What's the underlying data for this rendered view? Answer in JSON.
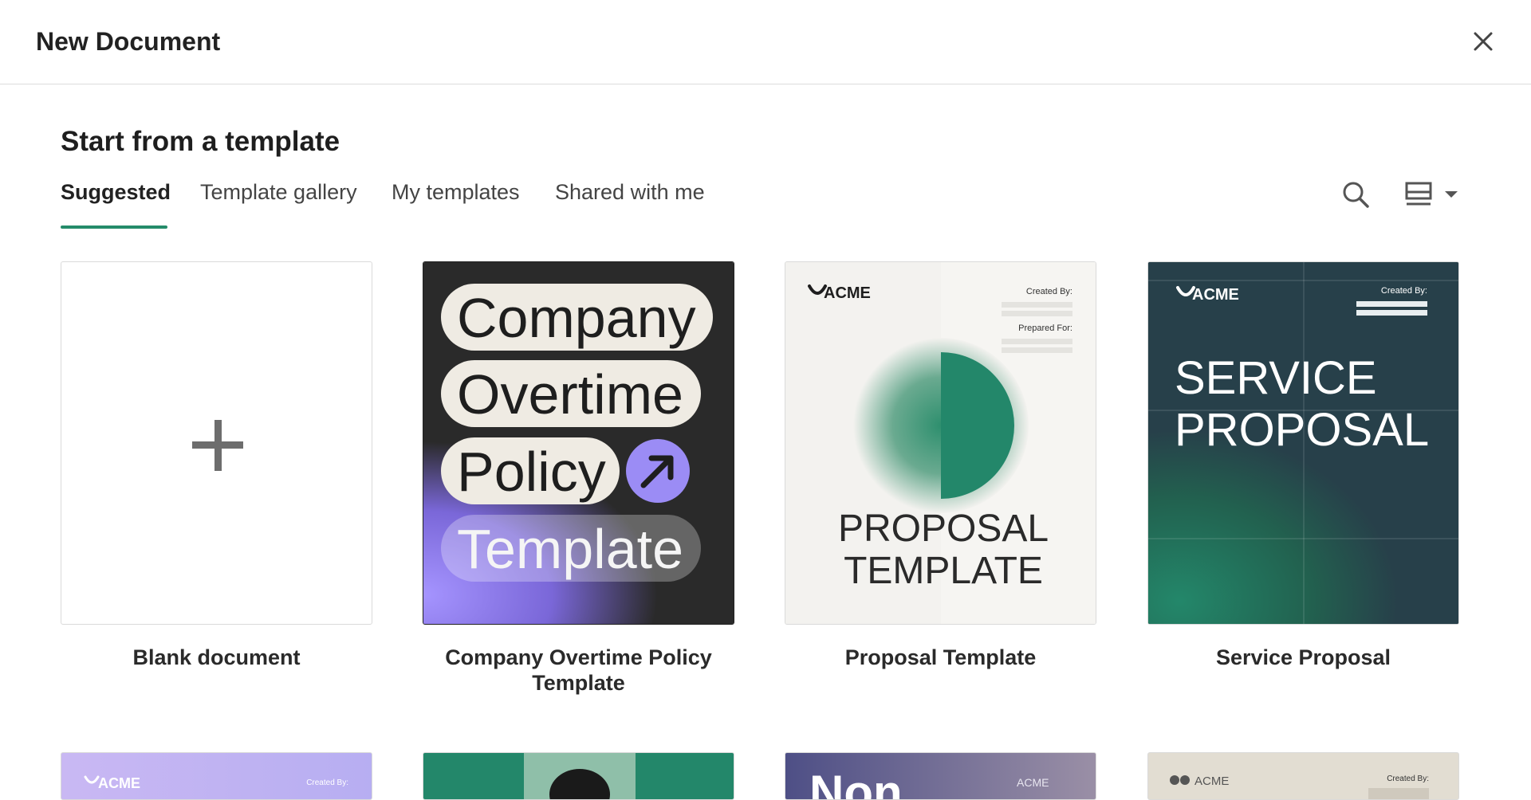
{
  "header": {
    "title": "New Document"
  },
  "section_title": "Start from a template",
  "tabs": [
    {
      "label": "Suggested",
      "active": true
    },
    {
      "label": "Template gallery"
    },
    {
      "label": "My templates"
    },
    {
      "label": "Shared with me"
    }
  ],
  "toolbar": {
    "search_icon": "search-icon",
    "view_icon": "list-view-icon"
  },
  "colors": {
    "accent": "#258c6a",
    "dark_teal": "#27404a",
    "purple": "#9b8cf5"
  },
  "templates": [
    {
      "label": "Blank document"
    },
    {
      "label": "Company Overtime Policy Template",
      "thumb": {
        "words": [
          "Company",
          "Overtime",
          "Policy",
          "Template"
        ]
      }
    },
    {
      "label": "Proposal Template",
      "thumb": {
        "brand": "ACME",
        "created_by": "Created By:",
        "prepared_for": "Prepared For:",
        "line1": "PROPOSAL",
        "line2": "TEMPLATE"
      }
    },
    {
      "label": "Service Proposal",
      "thumb": {
        "brand": "ACME",
        "created_by": "Created By:",
        "line1": "SERVICE",
        "line2": "PROPOSAL"
      }
    }
  ],
  "row2": [
    {
      "brand": "ACME",
      "created_by": "Created By:"
    },
    {},
    {
      "brand": "ACME",
      "partial_title": "Non"
    },
    {
      "brand": "ACME",
      "created_by": "Created By:"
    }
  ]
}
